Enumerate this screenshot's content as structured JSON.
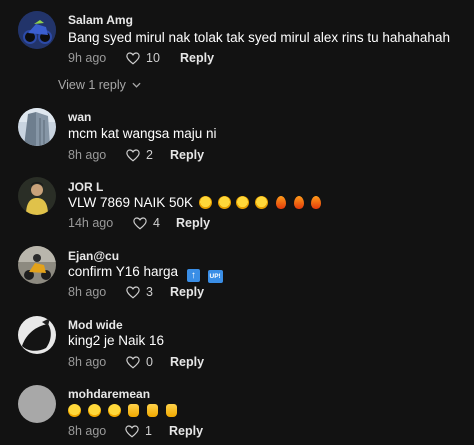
{
  "comments": [
    {
      "username": "Salam Amg",
      "text": "Bang syed mirul nak tolak tak syed mirul alex rins tu hahahahah",
      "time": "9h ago",
      "likes": "10",
      "reply_label": "Reply",
      "avatar": "racing-bike-photo"
    },
    {
      "username": "wan",
      "text": "mcm kat wangsa maju ni",
      "time": "8h ago",
      "likes": "2",
      "reply_label": "Reply",
      "avatar": "building-photo"
    },
    {
      "username": "JOR L",
      "text": "VLW 7869 NAIK 50K",
      "time": "14h ago",
      "likes": "4",
      "reply_label": "Reply",
      "avatar": "person-photo"
    },
    {
      "username": "Ejan@cu",
      "text": "confirm Y16 harga",
      "time": "8h ago",
      "likes": "3",
      "reply_label": "Reply",
      "avatar": "motorbike-photo"
    },
    {
      "username": "Mod wide",
      "text": "king2 je Naik 16",
      "time": "8h ago",
      "likes": "0",
      "reply_label": "Reply",
      "avatar": "dark-figure-photo"
    },
    {
      "username": "mohdaremean",
      "text": "",
      "time": "8h ago",
      "likes": "1",
      "reply_label": "Reply",
      "avatar": "default-grey-avatar"
    }
  ],
  "view_replies_label": "View 1 reply",
  "emoji": {
    "c3": [
      "rofl-emoji",
      "rofl-emoji",
      "rofl-emoji",
      "rofl-emoji",
      "fire-emoji",
      "fire-emoji",
      "fire-emoji"
    ],
    "c4": [
      "up-arrow-emoji",
      "up-button-emoji"
    ],
    "c4_up_text": "UP!",
    "c6": [
      "laughing-emoji",
      "laughing-emoji",
      "laughing-emoji",
      "thumbs-up-emoji",
      "thumbs-up-emoji",
      "thumbs-up-emoji"
    ]
  },
  "colors": {
    "background": "#121212",
    "username": "#e8e8e8",
    "meta": "#9a9a9a",
    "reply": "#e6e6e6"
  }
}
